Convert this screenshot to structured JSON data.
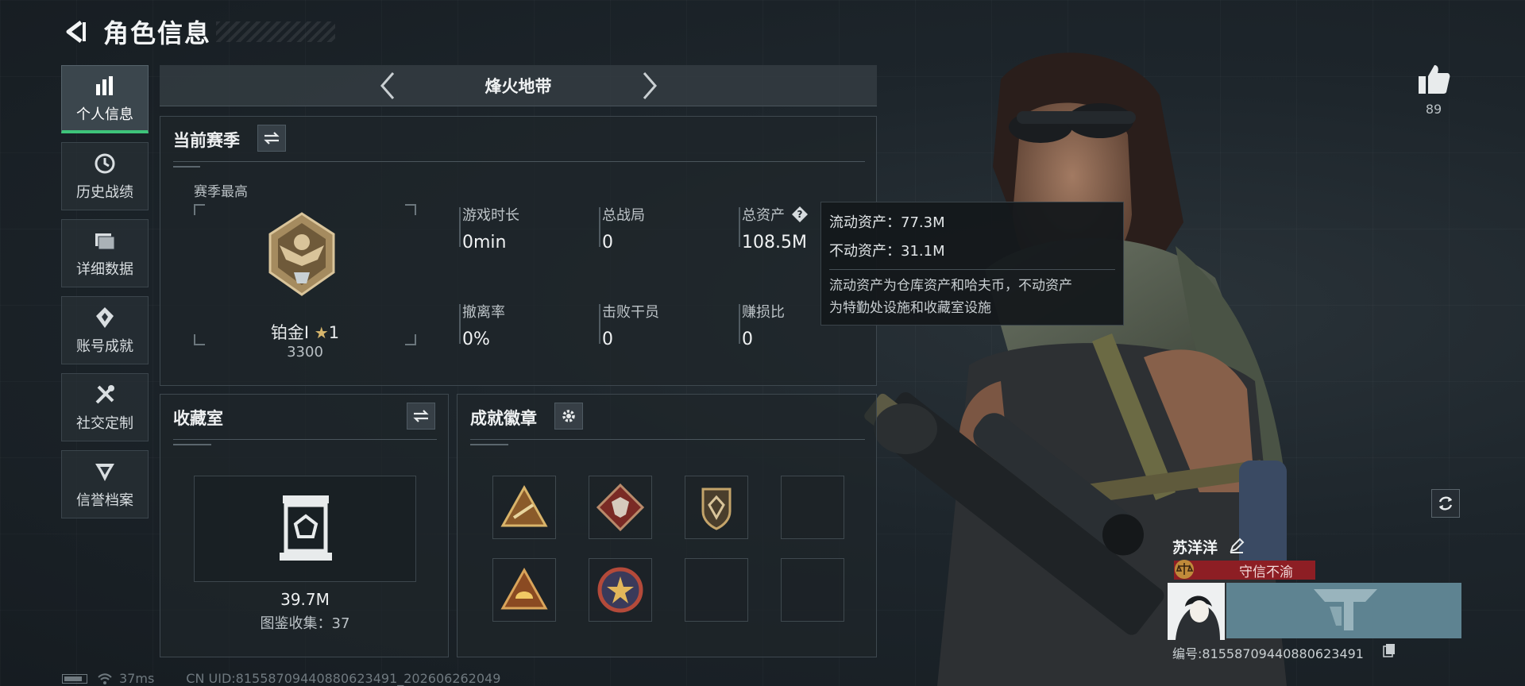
{
  "header": {
    "title": "角色信息"
  },
  "nav": {
    "items": [
      {
        "label": "个人信息",
        "icon": "bar-chart-icon",
        "active": true
      },
      {
        "label": "历史战绩",
        "icon": "history-icon",
        "active": false
      },
      {
        "label": "详细数据",
        "icon": "folder-icon",
        "active": false
      },
      {
        "label": "账号成就",
        "icon": "achievement-icon",
        "active": false
      },
      {
        "label": "社交定制",
        "icon": "tools-icon",
        "active": false
      },
      {
        "label": "信誉档案",
        "icon": "shield-rank-icon",
        "active": false
      }
    ]
  },
  "mode_selector": {
    "current": "烽火地带"
  },
  "season": {
    "title": "当前赛季",
    "best_label": "赛季最高",
    "rank": {
      "name": "铂金I",
      "stars": "1",
      "score": "3300"
    },
    "stats": [
      {
        "label": "游戏时长",
        "value": "0min"
      },
      {
        "label": "总战局",
        "value": "0"
      },
      {
        "label": "总资产",
        "value": "108.5M"
      },
      {
        "label": "撤离率",
        "value": "0%"
      },
      {
        "label": "击败干员",
        "value": "0"
      },
      {
        "label": "赚损比",
        "value": "0"
      }
    ]
  },
  "tooltip": {
    "liquid": "流动资产：77.3M",
    "fixed": "不动资产：31.1M",
    "desc_line1": "流动资产为仓库资产和哈夫币，不动资产",
    "desc_line2": "为特勤处设施和收藏室设施"
  },
  "collection": {
    "title": "收藏室",
    "value": "39.7M",
    "count": "图鉴收集：37"
  },
  "badges": {
    "title": "成就徽章"
  },
  "profile": {
    "likes": "89",
    "player_name": "苏洋洋",
    "title_tag": "守信不渝",
    "player_id": "编号:81558709440880623491"
  },
  "footer": {
    "ping": "37ms",
    "uid": "CN UID:81558709440880623491_202606262049"
  },
  "colors": {
    "accent_green": "#3ec47a",
    "title_red": "#8d1e24",
    "card_teal": "#5e8391"
  }
}
